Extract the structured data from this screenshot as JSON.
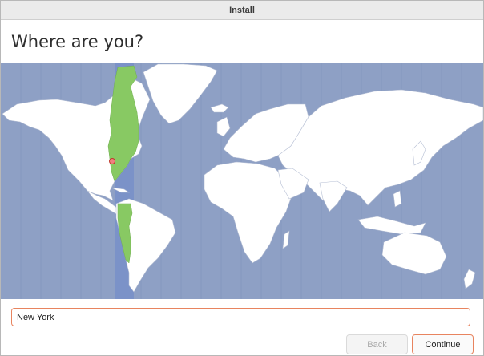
{
  "window": {
    "title": "Install"
  },
  "page": {
    "title": "Where are you?"
  },
  "location": {
    "value": "New York",
    "placeholder": ""
  },
  "buttons": {
    "back": "Back",
    "continue": "Continue"
  },
  "colors": {
    "ocean": "#8ea0c5",
    "timezone_band": "#7b92c8",
    "highlight": "#88c963",
    "land": "#ffffff",
    "accent": "#e8845f"
  },
  "selected_timezone": "America/New_York"
}
